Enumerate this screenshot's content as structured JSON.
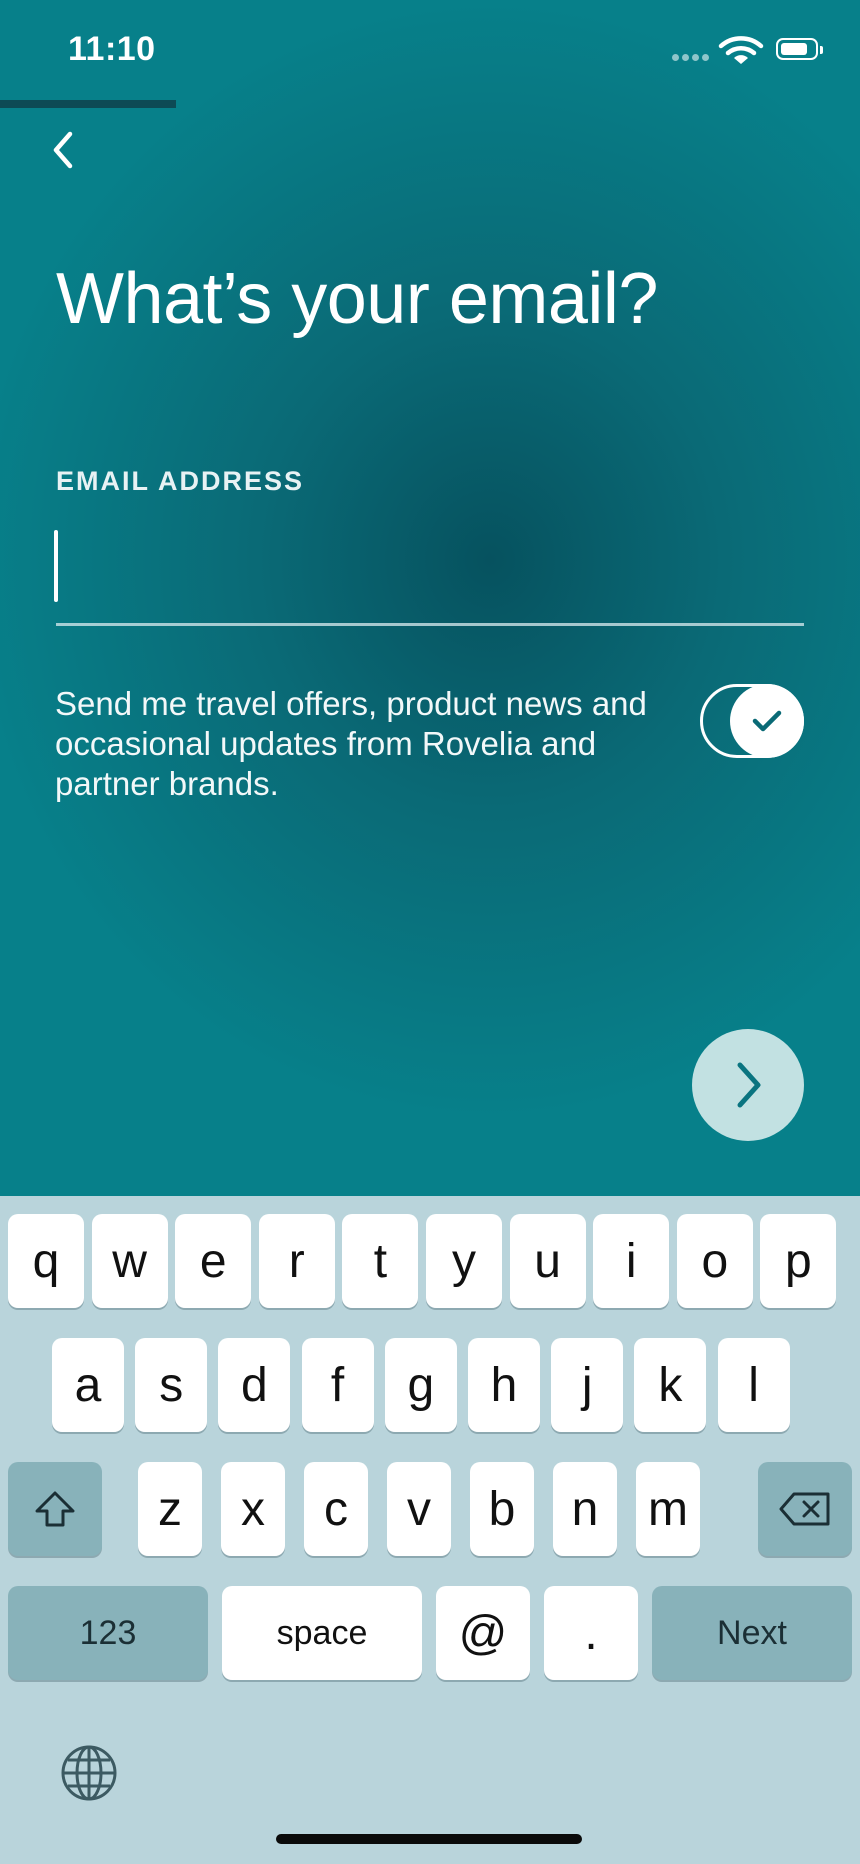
{
  "status_bar": {
    "time": "11:10"
  },
  "onboarding": {
    "progress_fraction": 0.205
  },
  "header": {
    "back_icon": "chevron-left-icon"
  },
  "page": {
    "title": "What’s your email?"
  },
  "email": {
    "label": "EMAIL ADDRESS",
    "value": ""
  },
  "consent": {
    "text": "Send me travel offers, product news and occasional updates from Rovelia and partner brands.",
    "enabled": true
  },
  "next_button": {
    "icon": "chevron-right-icon"
  },
  "keyboard": {
    "row1": [
      "q",
      "w",
      "e",
      "r",
      "t",
      "y",
      "u",
      "i",
      "o",
      "p"
    ],
    "row2": [
      "a",
      "s",
      "d",
      "f",
      "g",
      "h",
      "j",
      "k",
      "l"
    ],
    "row3": [
      "z",
      "x",
      "c",
      "v",
      "b",
      "n",
      "m"
    ],
    "numbers_label": "123",
    "space_label": "space",
    "at_label": "@",
    "dot_label": ".",
    "next_label": "Next",
    "shift_icon": "shift-icon",
    "delete_icon": "backspace-icon",
    "globe_icon": "globe-icon"
  },
  "colors": {
    "background_teal": "#07808a",
    "background_dark": "#06525f",
    "progress": "#0d4a55",
    "keyboard_bg": "#b9d4db",
    "fab": "#c2e1e2"
  }
}
